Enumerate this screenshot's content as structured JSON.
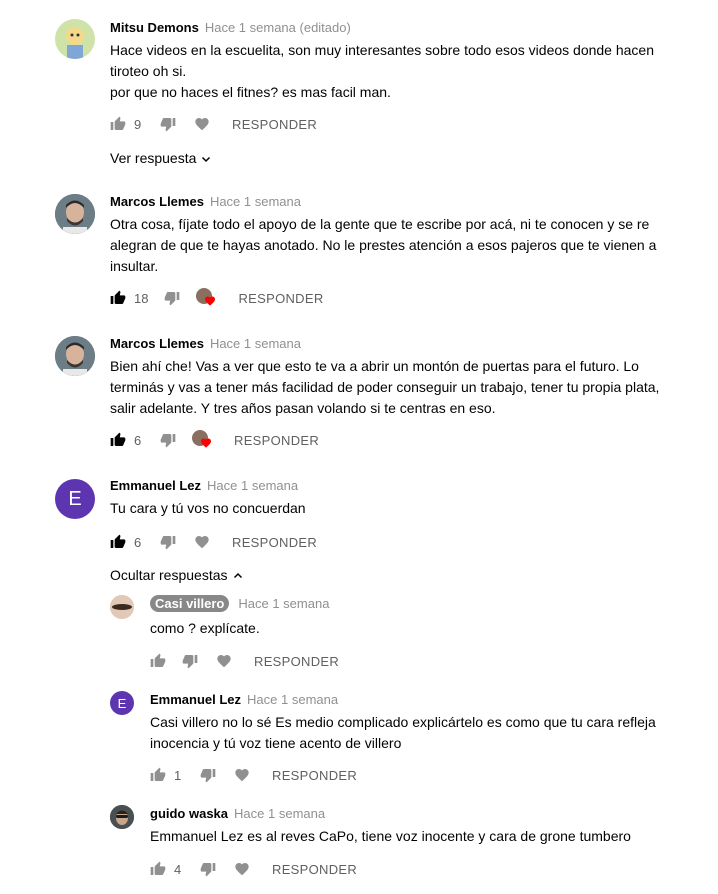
{
  "labels": {
    "reply": "RESPONDER",
    "view_reply": "Ver respuesta",
    "hide_replies": "Ocultar respuestas"
  },
  "comments": [
    {
      "author": "Mitsu Demons",
      "time": "Hace 1 semana (editado)",
      "text": "Hace videos en la escuelita, son muy interesantes sobre todo esos videos donde hacen tiroteo oh si.\n por que no haces el fitnes? es mas facil man.",
      "likes": "9"
    },
    {
      "author": "Marcos Llemes",
      "time": "Hace 1 semana",
      "text": "Otra cosa, fíjate todo el apoyo de la gente que te escribe por acá, ni te conocen y se re alegran de que te hayas anotado. No le prestes atención a esos pajeros que te vienen a insultar.",
      "likes": "18"
    },
    {
      "author": "Marcos Llemes",
      "time": "Hace 1 semana",
      "text": "Bien ahí che! Vas a ver que esto te va a abrir un montón de puertas para el futuro. Lo terminás y vas a tener más facilidad de poder conseguir un trabajo, tener tu propia plata, salir adelante. Y tres años pasan volando si te centras en eso.",
      "likes": "6"
    },
    {
      "author": "Emmanuel Lez",
      "avatar_letter": "E",
      "time": "Hace 1 semana",
      "text": "Tu cara y tú vos no concuerdan",
      "likes": "6"
    }
  ],
  "replies": [
    {
      "author": "Casi villero",
      "time": "Hace 1 semana",
      "text": "como ? explícate.",
      "likes": ""
    },
    {
      "author": "Emmanuel Lez",
      "avatar_letter": "E",
      "time": "Hace 1 semana",
      "text": "Casi villero no lo sé Es medio complicado explicártelo es como que tu cara refleja inocencia y tú voz tiene acento de villero",
      "likes": "1"
    },
    {
      "author": "guido waska",
      "time": "Hace 1 semana",
      "text": "Emmanuel Lez es al reves CaPo, tiene voz inocente y cara de grone tumbero",
      "likes": "4"
    }
  ],
  "colors": {
    "author_text": "#030303",
    "meta_gray": "#909090",
    "action_gray": "#606060",
    "letter_avatar": "#5e35b1",
    "heart_red": "#ff0000"
  }
}
